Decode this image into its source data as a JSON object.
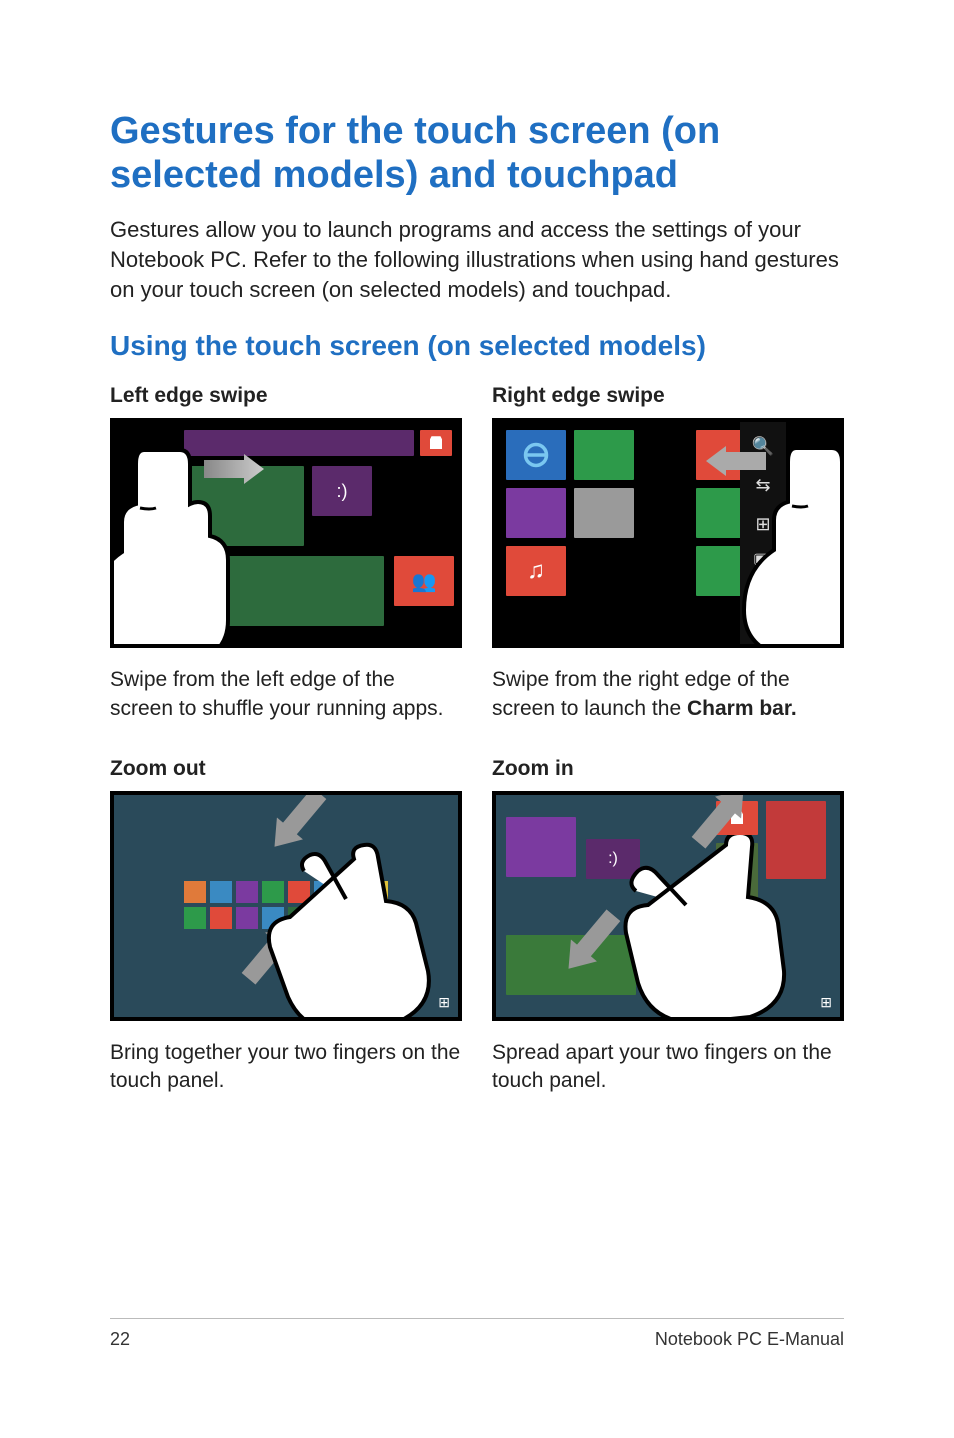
{
  "title": "Gestures for the touch screen (on selected models) and touchpad",
  "intro": "Gestures allow you to launch programs and access the settings of your Notebook PC. Refer to the following illustrations when using hand gestures on your touch screen (on selected models) and touchpad.",
  "subtitle": "Using the touch screen (on selected models)",
  "gestures": {
    "left_edge": {
      "title": "Left edge swipe",
      "desc": "Swipe from the left edge of the screen to shuffle your running apps."
    },
    "right_edge": {
      "title": "Right edge swipe",
      "desc_pre": "Swipe from the right edge of the screen to launch the ",
      "desc_bold": "Charm bar."
    },
    "zoom_out": {
      "title": "Zoom out",
      "desc": "Bring together your two fingers on the touch panel."
    },
    "zoom_in": {
      "title": "Zoom in",
      "desc": "Spread apart your two fingers on the touch panel."
    }
  },
  "footer": {
    "page": "22",
    "doc": "Notebook PC E-Manual"
  }
}
